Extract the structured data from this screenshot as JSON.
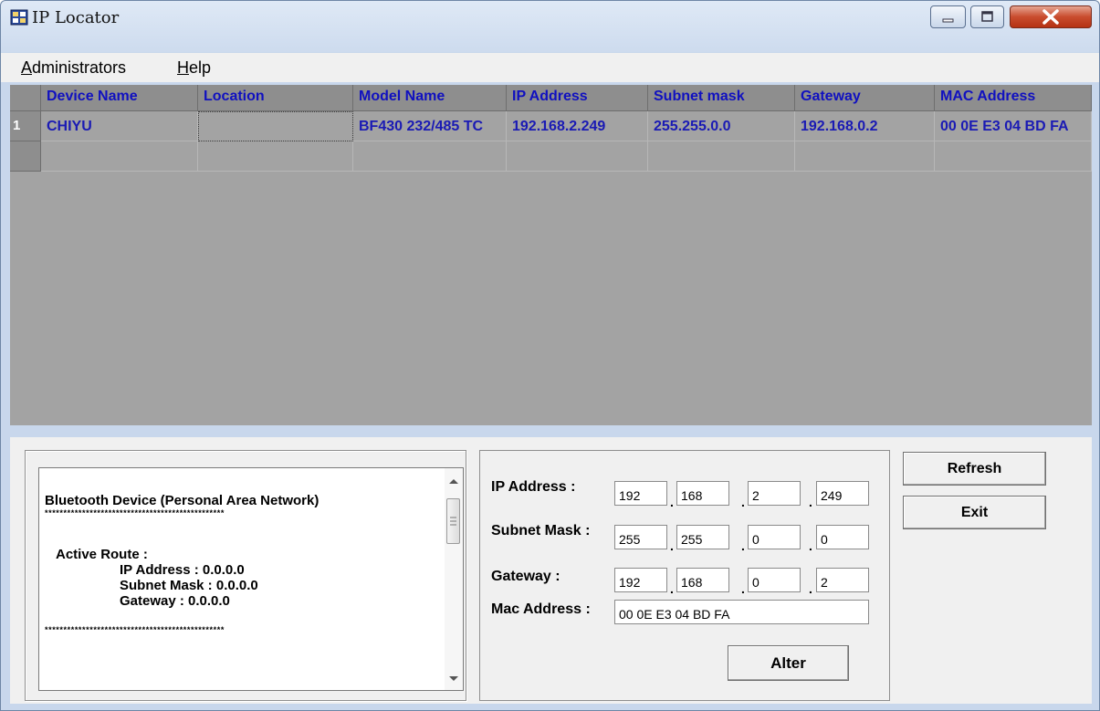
{
  "window": {
    "title": "IP Locator"
  },
  "menu": {
    "items": [
      "Administrators",
      "Help"
    ]
  },
  "grid": {
    "columns": [
      "Device Name",
      "Location",
      "Model Name",
      "IP Address",
      "Subnet mask",
      "Gateway",
      "MAC Address"
    ],
    "rows": [
      {
        "num": "1",
        "cells": [
          "CHIYU",
          "",
          "BF430 232/485 TC",
          "192.168.2.249",
          "255.255.0.0",
          "192.168.0.2",
          "00 0E E3 04 BD FA"
        ]
      }
    ]
  },
  "info": {
    "adapter": "Bluetooth Device (Personal Area Network)",
    "separator": "************************************************",
    "route_label": "Active Route :",
    "ip_line": "IP Address : 0.0.0.0",
    "mask_line": "Subnet Mask : 0.0.0.0",
    "gw_line": "Gateway : 0.0.0.0"
  },
  "form": {
    "ip_label": "IP Address :",
    "ip": [
      "192",
      "168",
      "2",
      "249"
    ],
    "mask_label": "Subnet Mask :",
    "mask": [
      "255",
      "255",
      "0",
      "0"
    ],
    "gw_label": "Gateway :",
    "gw": [
      "192",
      "168",
      "0",
      "2"
    ],
    "mac_label": "Mac Address :",
    "mac": "00 0E E3 04 BD FA",
    "alter_label": "Alter"
  },
  "buttons": {
    "refresh": "Refresh",
    "exit": "Exit"
  },
  "icons": {
    "app": "app-grid-icon",
    "minimize": "minimize-icon",
    "maximize": "maximize-icon",
    "close": "close-icon"
  }
}
